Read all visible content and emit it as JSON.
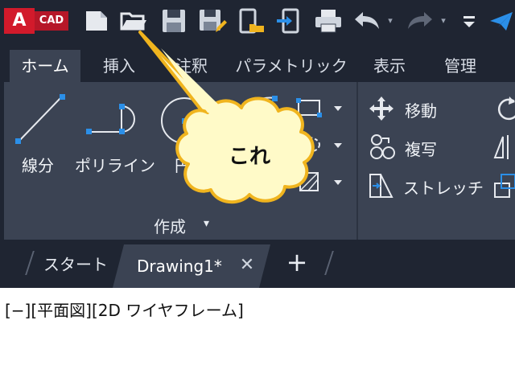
{
  "app": {
    "logo_letter": "A",
    "logo_text": "CAD"
  },
  "qat": {
    "icons": [
      "new-icon",
      "open-icon",
      "save-icon",
      "save-as-icon",
      "open-from-mobile-icon",
      "save-to-mobile-icon",
      "plot-icon",
      "undo-icon",
      "redo-icon",
      "customize-icon",
      "share-icon"
    ],
    "dropdown_glyph": "▾"
  },
  "tabs": [
    {
      "label": "ホーム",
      "active": true
    },
    {
      "label": "挿入"
    },
    {
      "label": "注釈"
    },
    {
      "label": "パラメトリック"
    },
    {
      "label": "表示"
    },
    {
      "label": "管理"
    }
  ],
  "draw_panel": {
    "title": "作成",
    "arrow": "▾",
    "tools": [
      {
        "label": "線分",
        "icon": "line-icon"
      },
      {
        "label": "ポリライン",
        "icon": "polyline-icon"
      },
      {
        "label": "円",
        "icon": "circle-icon"
      }
    ],
    "small_tools": [
      "arc-icon",
      "rectangle-icon",
      "ellipse-icon",
      "hatch-icon"
    ]
  },
  "modify_panel": {
    "tools": [
      {
        "label": "移動",
        "icon": "move-icon"
      },
      {
        "label": "複写",
        "icon": "copy-icon"
      },
      {
        "label": "ストレッチ",
        "icon": "stretch-icon"
      }
    ],
    "small_tools": [
      "rotate-icon",
      "mirror-icon",
      "scale-icon"
    ]
  },
  "doc_tabs": {
    "start": "スタート",
    "active": "Drawing1*",
    "close_glyph": "✕",
    "new_glyph": "+"
  },
  "canvas": {
    "viewport_label": "[−][平面図][2D ワイヤフレーム]"
  },
  "callout": {
    "text": "これ"
  },
  "colors": {
    "accent_red": "#d21a2b",
    "ribbon_bg": "#3b4353",
    "chrome_bg": "#1f2532",
    "select_blue": "#2b8fe8",
    "callout_fill": "#fffac8",
    "callout_stroke": "#f0b41e"
  }
}
